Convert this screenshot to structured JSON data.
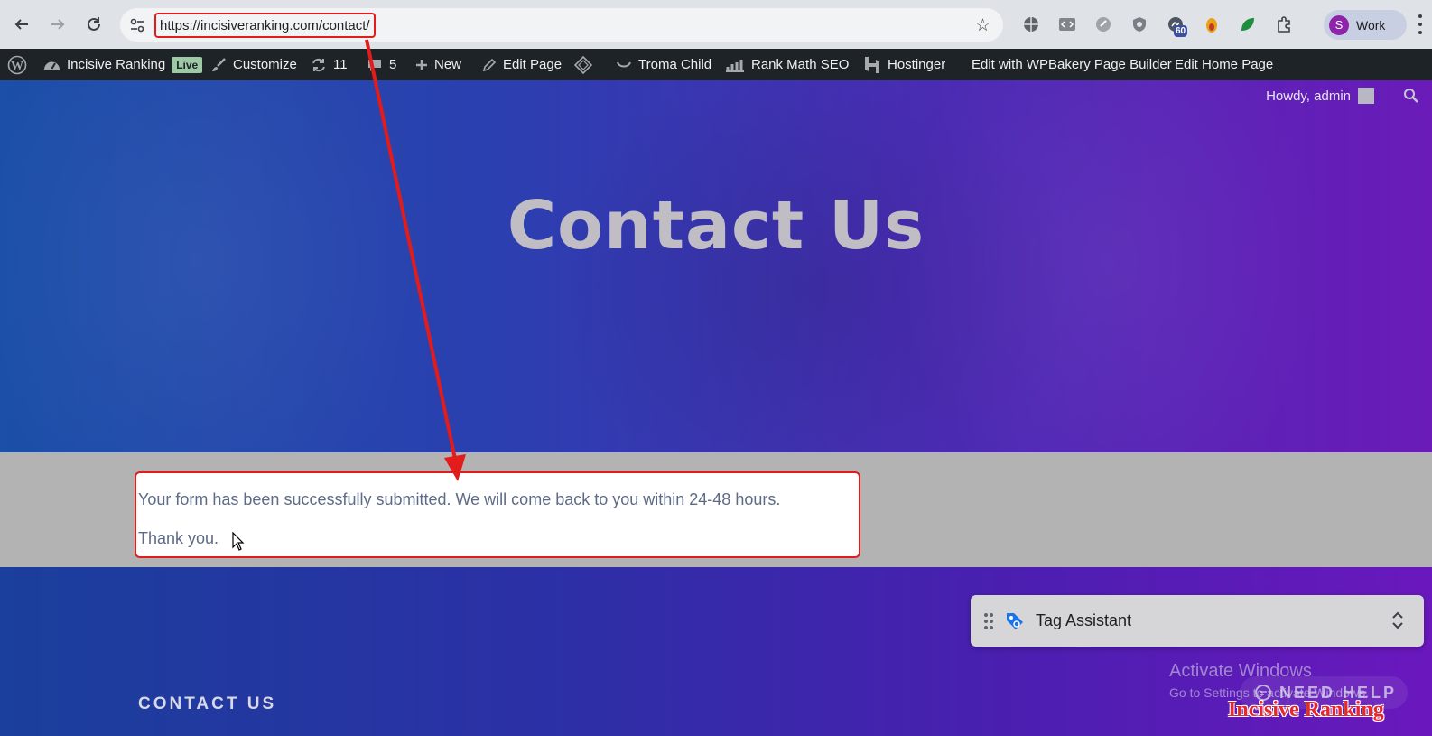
{
  "browser": {
    "url": "https://incisiveranking.com/contact/",
    "profile_initial": "S",
    "profile_label": "Work",
    "extension_badge": "60"
  },
  "adminbar": {
    "site_name": "Incisive Ranking",
    "live_badge": "Live",
    "customize": "Customize",
    "updates_count": "11",
    "comments_count": "5",
    "new": "New",
    "edit_page": "Edit Page",
    "theme": "Troma Child",
    "rank_math": "Rank Math SEO",
    "hostinger": "Hostinger",
    "wpbakery": "Edit with WPBakery Page Builder",
    "edit_home": "Edit Home Page"
  },
  "hero": {
    "howdy": "Howdy, admin",
    "title": "Contact Us"
  },
  "message": {
    "line1": "Your form has been successfully submitted. We will come back to you within 24-48 hours.",
    "line2": "Thank you."
  },
  "footer": {
    "title": "CONTACT US",
    "tag_assistant": "Tag Assistant",
    "activate_title": "Activate Windows",
    "activate_sub": "Go to Settings to activate Windows.",
    "need_help": "NEED HELP",
    "watermark": "Incisive Ranking"
  },
  "colors": {
    "annotation_red": "#e21b1b",
    "admin_bar": "#1d2327",
    "hero_start": "#1b4fa8",
    "hero_end": "#6a1bb8"
  }
}
